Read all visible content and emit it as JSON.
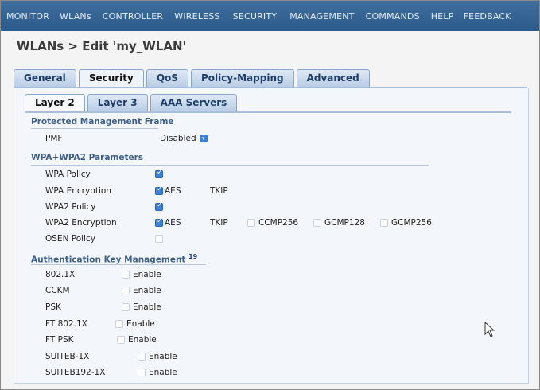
{
  "nav": [
    "MONITOR",
    "WLANs",
    "CONTROLLER",
    "WIRELESS",
    "SECURITY",
    "MANAGEMENT",
    "COMMANDS",
    "HELP",
    "FEEDBACK"
  ],
  "breadcrumb": "WLANs > Edit  'my_WLAN'",
  "tabs": [
    "General",
    "Security",
    "QoS",
    "Policy-Mapping",
    "Advanced"
  ],
  "active_tab": "Security",
  "subtabs": [
    "Layer 2",
    "Layer 3",
    "AAA Servers"
  ],
  "active_subtab": "Layer 2",
  "pmf": {
    "section": "Protected Management Frame",
    "label": "PMF",
    "value": "Disabled"
  },
  "wpa": {
    "section": "WPA+WPA2 Parameters",
    "wpa_policy": "WPA Policy",
    "wpa_encryption": "WPA Encryption",
    "wpa2_policy": "WPA2 Policy",
    "wpa2_encryption": "WPA2 Encryption",
    "osen_policy": "OSEN Policy",
    "aes": "AES",
    "tkip": "TKIP",
    "ccmp256": "CCMP256",
    "gcmp128": "GCMP128",
    "gcmp256": "GCMP256"
  },
  "akm": {
    "section": "Authentication Key Management",
    "footnote": "19",
    "enable": "Enable",
    "items": [
      "802.1X",
      "CCKM",
      "PSK",
      "FT 802.1X",
      "FT PSK",
      "SUITEB-1X",
      "SUITEB192-1X"
    ]
  },
  "colors": {
    "nav_bg": "#2c5a8a",
    "checkbox_on": "#3d7fd6",
    "section_text": "#3c5f8a"
  }
}
